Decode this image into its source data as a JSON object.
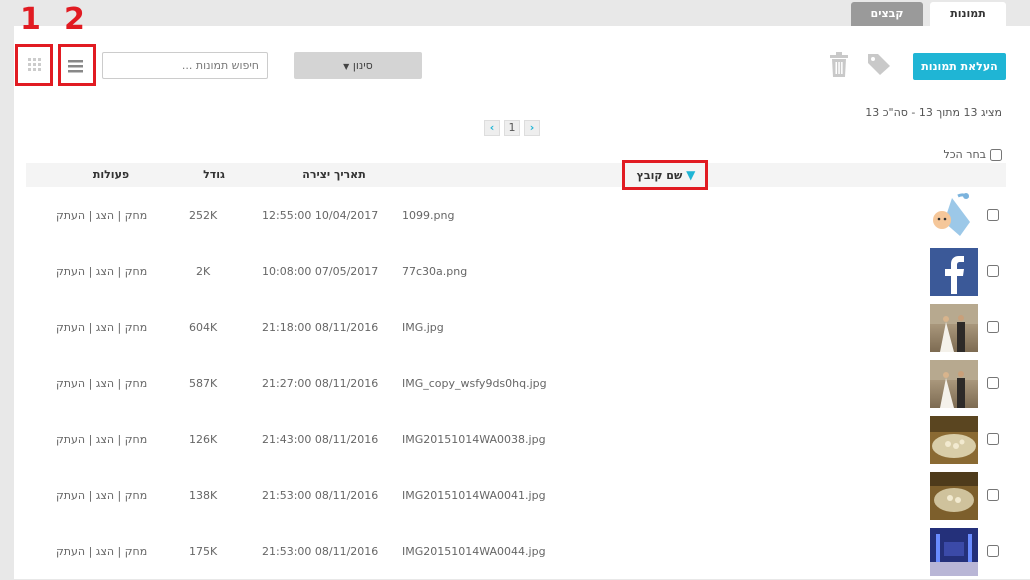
{
  "tabs": [
    {
      "label": "תמונות",
      "active": true
    },
    {
      "label": "קבצים",
      "active": false
    }
  ],
  "markers": [
    "1",
    "2"
  ],
  "toolbar": {
    "upload_label": "העלאת תמונות",
    "filter_label": "סינון",
    "search_placeholder": "חיפוש תמונות ..."
  },
  "status_text": "מציג 13 מתוך 13 - סה\"כ 13",
  "pagination": {
    "current": "1"
  },
  "select_all_label": "בחר הכל",
  "columns": {
    "filename": "שם קובץ",
    "created": "תאריך יצירה",
    "size": "גודל",
    "actions": "פעולות"
  },
  "rows": [
    {
      "filename": "1099.png",
      "created": "12:55:00 10/04/2017",
      "size": "252K",
      "actions": "מחק | הצג | העתק",
      "thumb": "baby-stork"
    },
    {
      "filename": "77c30a.png",
      "created": "10:08:00 07/05/2017",
      "size": "2K",
      "actions": "מחק | הצג | העתק",
      "thumb": "facebook-logo"
    },
    {
      "filename": "IMG.jpg",
      "created": "21:18:00 08/11/2016",
      "size": "604K",
      "actions": "מחק | הצג | העתק",
      "thumb": "wedding-couple"
    },
    {
      "filename": "IMG_copy_wsfy9ds0hq.jpg",
      "created": "21:27:00 08/11/2016",
      "size": "587K",
      "actions": "מחק | הצג | העתק",
      "thumb": "wedding-couple"
    },
    {
      "filename": "IMG20151014WA0038.jpg",
      "created": "21:43:00 08/11/2016",
      "size": "126K",
      "actions": "מחק | הצג | העתק",
      "thumb": "flowers-table"
    },
    {
      "filename": "IMG20151014WA0041.jpg",
      "created": "21:53:00 08/11/2016",
      "size": "138K",
      "actions": "מחק | הצג | העתק",
      "thumb": "flowers-table"
    },
    {
      "filename": "IMG20151014WA0044.jpg",
      "created": "21:53:00 08/11/2016",
      "size": "175K",
      "actions": "מחק | הצג | העתק",
      "thumb": "event-hall"
    }
  ],
  "colors": {
    "accent": "#1fb5d5",
    "highlight": "#e11b22"
  }
}
